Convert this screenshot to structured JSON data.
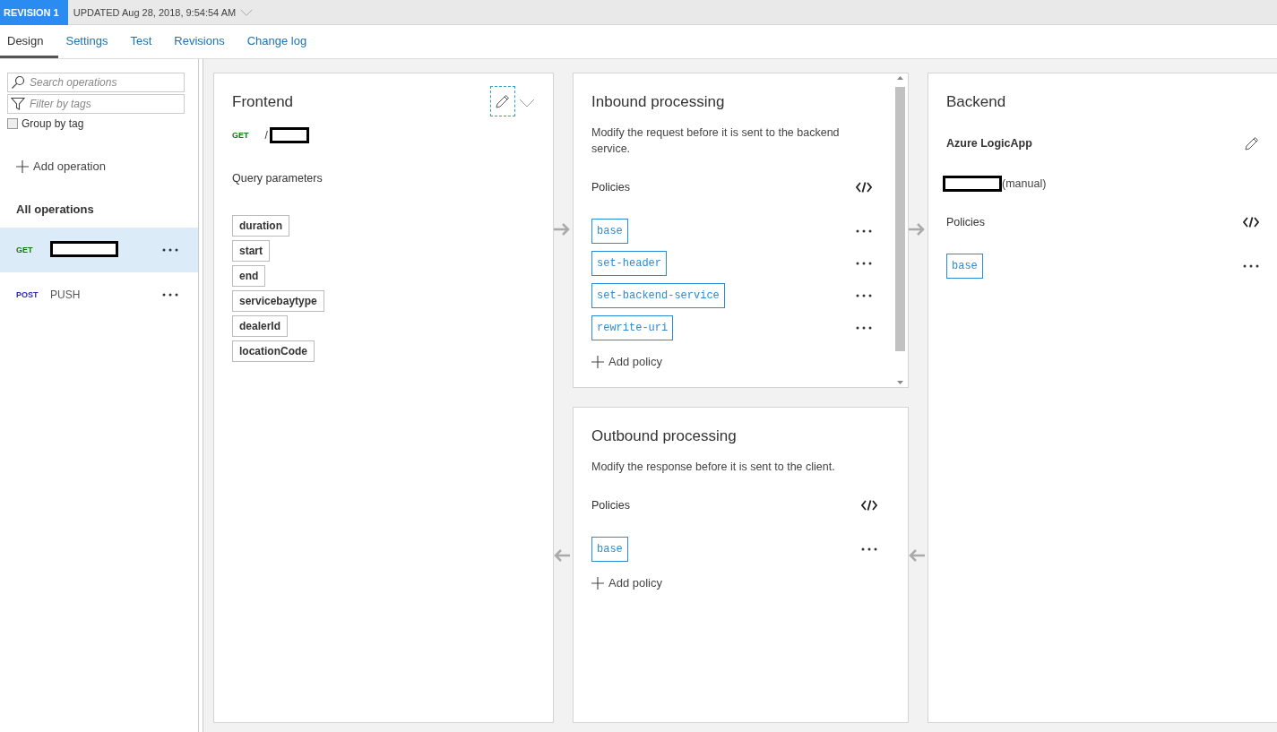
{
  "revision": {
    "badge": "REVISION 1",
    "updated": "UPDATED Aug 28, 2018, 9:54:54 AM"
  },
  "tabs": [
    {
      "label": "Design",
      "selected": true
    },
    {
      "label": "Settings",
      "selected": false
    },
    {
      "label": "Test",
      "selected": false
    },
    {
      "label": "Revisions",
      "selected": false
    },
    {
      "label": "Change log",
      "selected": false
    }
  ],
  "sidebar": {
    "search": {
      "placeholder": "Search operations"
    },
    "filter": {
      "placeholder": "Filter by tags"
    },
    "group_by_tag": {
      "label": "Group by tag",
      "checked": false
    },
    "add_operation": "Add operation",
    "all_operations": "All operations",
    "operations": [
      {
        "method": "GET",
        "redacted": true,
        "selected": true
      },
      {
        "method": "POST",
        "name": "PUSH",
        "selected": false
      }
    ]
  },
  "frontend": {
    "title": "Frontend",
    "method": "GET",
    "path": "/",
    "query_title": "Query parameters",
    "params": [
      "duration",
      "start",
      "end",
      "servicebaytype",
      "dealerId",
      "locationCode"
    ]
  },
  "inbound": {
    "title": "Inbound processing",
    "description": "Modify the request before it is sent to the backend service.",
    "policies_label": "Policies",
    "policies": [
      "base",
      "set-header",
      "set-backend-service",
      "rewrite-uri"
    ],
    "add_policy": "Add policy"
  },
  "outbound": {
    "title": "Outbound processing",
    "description": "Modify the response before it is sent to the client.",
    "policies_label": "Policies",
    "policies": [
      "base"
    ],
    "add_policy": "Add policy"
  },
  "backend": {
    "title": "Backend",
    "service": "Azure LogicApp",
    "endpoint_suffix": "(manual)",
    "policies_label": "Policies",
    "policies": [
      "base"
    ]
  }
}
